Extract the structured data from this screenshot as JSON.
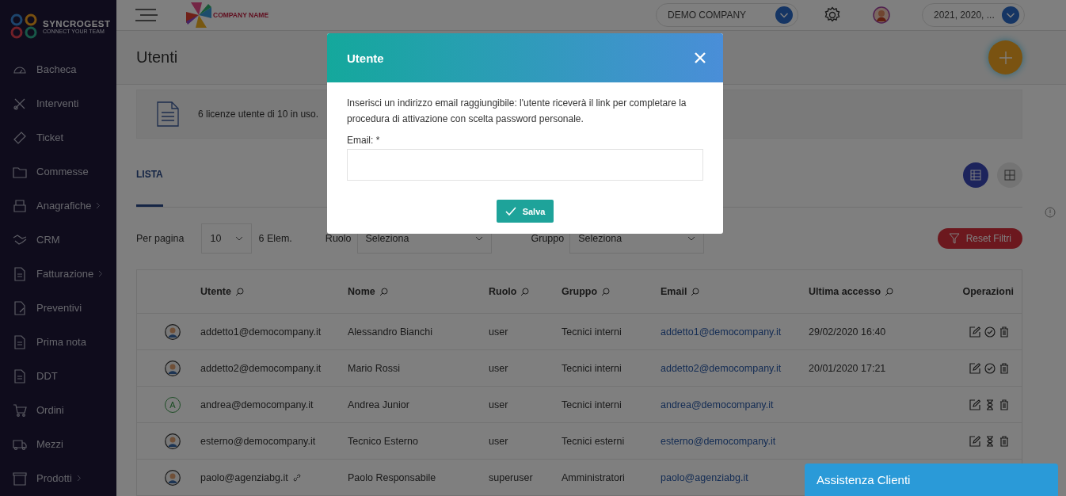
{
  "brand": {
    "name": "SYNCROGEST",
    "tagline": "CONNECT YOUR TEAM"
  },
  "sidebar": {
    "items": [
      {
        "label": "Bacheca",
        "submenu": false
      },
      {
        "label": "Interventi",
        "submenu": false
      },
      {
        "label": "Ticket",
        "submenu": false
      },
      {
        "label": "Commesse",
        "submenu": false
      },
      {
        "label": "Anagrafiche",
        "submenu": true
      },
      {
        "label": "CRM",
        "submenu": false
      },
      {
        "label": "Fatturazione",
        "submenu": true
      },
      {
        "label": "Preventivi",
        "submenu": false
      },
      {
        "label": "Prima nota",
        "submenu": false
      },
      {
        "label": "DDT",
        "submenu": false
      },
      {
        "label": "Ordini",
        "submenu": false
      },
      {
        "label": "Mezzi",
        "submenu": false
      },
      {
        "label": "Prodotti",
        "submenu": true
      }
    ]
  },
  "topbar": {
    "logo_text": "COMPANY NAME",
    "company": "DEMO COMPANY",
    "years": "2021, 2020, ..."
  },
  "page": {
    "title": "Utenti",
    "license_info": "6 licenze utente di 10 in uso."
  },
  "tabs": [
    {
      "label": "LISTA",
      "selected": true
    }
  ],
  "view_toggle": [
    {
      "kind": "table",
      "selected": true
    },
    {
      "kind": "grid",
      "selected": false
    }
  ],
  "filters": {
    "per_page_label": "Per pagina",
    "per_page": "10",
    "count": "6 Elem.",
    "role_label": "Ruolo",
    "role_value": "Seleziona",
    "group_label": "Gruppo",
    "group_value": "Seleziona",
    "reset": "Reset Filtri"
  },
  "table": {
    "columns": [
      "Utente",
      "Nome",
      "Ruolo",
      "Gruppo",
      "Email",
      "Ultima accesso",
      "Operazioni"
    ],
    "rows": [
      {
        "avatar": {
          "kind": "figure"
        },
        "user": "addetto1@democompany.it",
        "linked": false,
        "name": "Alessandro Bianchi",
        "role": "user",
        "group": "Tecnici interni",
        "email": "addetto1@democompany.it",
        "last_access": "29/02/2020 16:40",
        "kind": "active"
      },
      {
        "avatar": {
          "kind": "figure"
        },
        "user": "addetto2@democompany.it",
        "linked": false,
        "name": "Mario Rossi",
        "role": "user",
        "group": "Tecnici interni",
        "email": "addetto2@democompany.it",
        "last_access": "20/01/2020 17:21",
        "kind": "active"
      },
      {
        "avatar": {
          "kind": "letter",
          "letter": "A"
        },
        "user": "andrea@democompany.it",
        "linked": false,
        "name": "Andrea Junior",
        "role": "user",
        "group": "Tecnici interni",
        "email": "andrea@democompany.it",
        "kind": "pending"
      },
      {
        "avatar": {
          "kind": "figure"
        },
        "user": "esterno@democompany.it",
        "linked": false,
        "name": "Tecnico Esterno",
        "role": "user",
        "group": "Tecnici esterni",
        "email": "esterno@democompany.it",
        "kind": "pending"
      },
      {
        "avatar": {
          "kind": "figure"
        },
        "user": "paolo@agenziabg.it",
        "linked": true,
        "name": "Paolo Responsabile",
        "role": "superuser",
        "group": "Amministratori",
        "email": "paolo@agenziabg.it"
      }
    ]
  },
  "modal": {
    "title": "Utente",
    "message": "Inserisci un indirizzo email raggiungibile: l'utente riceverà il link per completare la procedura di attivazione con scelta password personale.",
    "email_label": "Email: *",
    "save": "Salva"
  },
  "chat": {
    "label": "Assistenza Clienti"
  }
}
